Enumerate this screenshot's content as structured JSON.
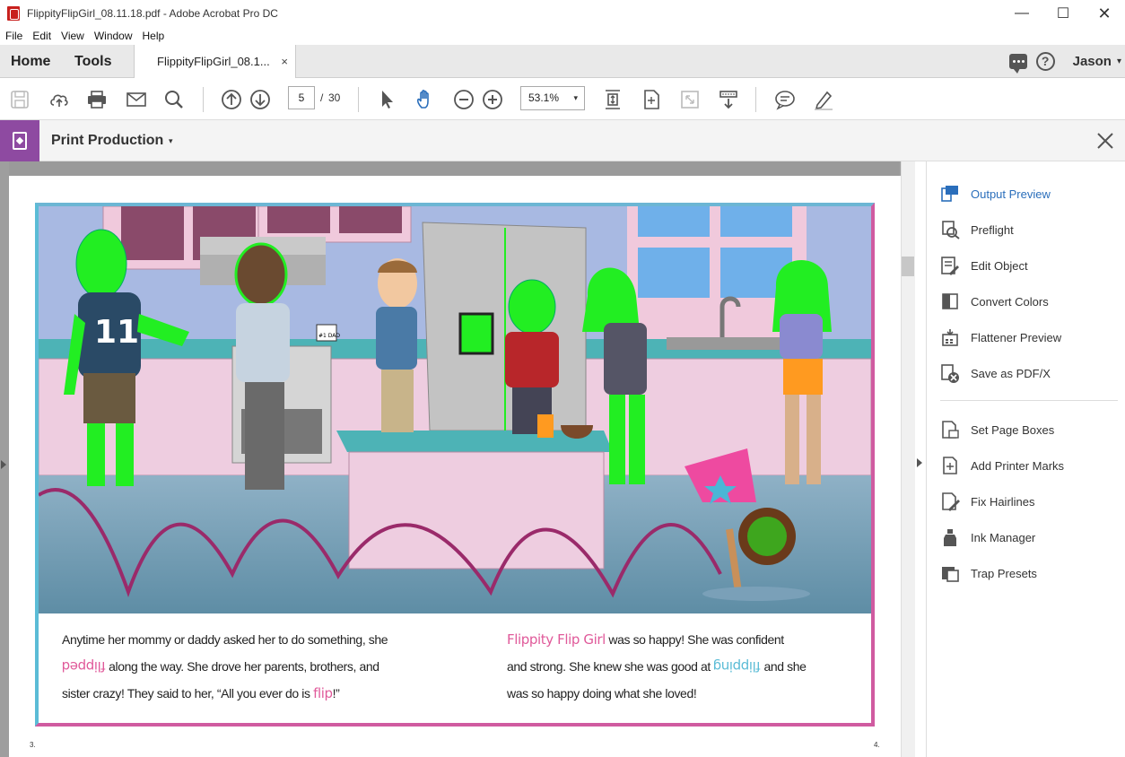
{
  "window": {
    "title": "FlippityFlipGirl_08.11.18.pdf - Adobe Acrobat Pro DC",
    "minimize": "—",
    "maximize": "☐",
    "close": "✕"
  },
  "menu": [
    "File",
    "Edit",
    "View",
    "Window",
    "Help"
  ],
  "tabs": {
    "home": "Home",
    "tools": "Tools",
    "document": "FlippityFlipGirl_08.1...",
    "document_close": "×",
    "user": "Jason",
    "user_chevron": "▾",
    "help": "?"
  },
  "toolbar": {
    "page_current": "5",
    "page_separator": "/",
    "page_total": "30",
    "zoom": "53.1%",
    "zoom_chevron": "▾"
  },
  "tool_header": {
    "title": "Print Production",
    "chevron": "▾"
  },
  "page": {
    "left_paragraph": {
      "line1": "Anytime her mommy or daddy asked her to do something, she",
      "flipped": "flipped",
      "line2_rest": "along the way. She drove her parents, brothers, and",
      "line3": "sister crazy! They said to her, “All you ever do is",
      "flip": "flip",
      "line3_end": "!”"
    },
    "right_paragraph": {
      "brand": "Flippity Flip Girl",
      "line1_rest": "was so happy! She was confident",
      "line2": "and strong. She knew she was good at",
      "flipping": "flipping",
      "line2_end": "and she",
      "line3": "was so happy doing what she loved!"
    },
    "num_left": "3.",
    "num_right": "4.",
    "mug_label": "#1 DAD",
    "jersey_number": "11"
  },
  "right_panel": {
    "items": [
      {
        "label": "Output Preview",
        "icon": "output-preview-icon",
        "active": true
      },
      {
        "label": "Preflight",
        "icon": "preflight-icon",
        "active": false
      },
      {
        "label": "Edit Object",
        "icon": "edit-object-icon",
        "active": false
      },
      {
        "label": "Convert Colors",
        "icon": "convert-colors-icon",
        "active": false
      },
      {
        "label": "Flattener Preview",
        "icon": "flattener-preview-icon",
        "active": false
      },
      {
        "label": "Save as PDF/X",
        "icon": "save-pdfx-icon",
        "active": false
      },
      {
        "label": "Set Page Boxes",
        "icon": "set-page-boxes-icon",
        "active": false
      },
      {
        "label": "Add Printer Marks",
        "icon": "add-printer-marks-icon",
        "active": false
      },
      {
        "label": "Fix Hairlines",
        "icon": "fix-hairlines-icon",
        "active": false
      },
      {
        "label": "Ink Manager",
        "icon": "ink-manager-icon",
        "active": false
      },
      {
        "label": "Trap Presets",
        "icon": "trap-presets-icon",
        "active": false
      }
    ]
  },
  "colors": {
    "accent": "#2a6ebb",
    "tool_badge": "#8e4aa1",
    "highlight_green": "#22ee22",
    "frame_pink": "#d05ba0",
    "frame_blue": "#5bbcd6"
  }
}
